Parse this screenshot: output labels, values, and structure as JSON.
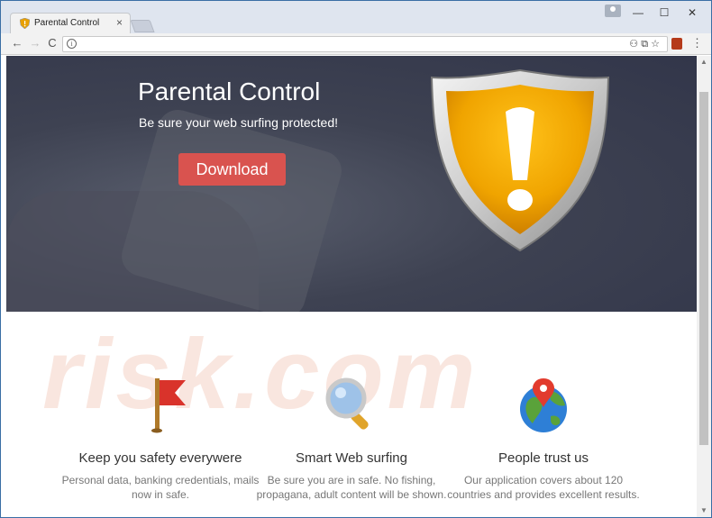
{
  "browser": {
    "tab_title": "Parental Control",
    "tab_close": "×",
    "controls": {
      "minimize": "—",
      "maximize": "☐",
      "close": "✕"
    },
    "nav": {
      "back": "←",
      "forward": "→",
      "reload": "C"
    },
    "omnibox_info": "i",
    "omnibox_icons": "⚇ ⧉ ☆",
    "menu": "⋮"
  },
  "hero": {
    "title": "Parental Control",
    "subtitle": "Be sure your web surfing protected!",
    "download_label": "Download"
  },
  "watermark": "risk.com",
  "features": [
    {
      "icon": "flag-icon",
      "title": "Keep you safety everywere",
      "desc": "Personal data, banking credentials, mails now in safe."
    },
    {
      "icon": "magnifier-icon",
      "title": "Smart Web surfing",
      "desc": "Be sure you are in safe. No fishing, propagana, adult content will be shown."
    },
    {
      "icon": "globe-pin-icon",
      "title": "People trust us",
      "desc": "Our application covers about 120 countries and provides excellent results."
    }
  ],
  "colors": {
    "download_button": "#d9534f",
    "shield_orange": "#f0a400",
    "window_border": "#3a6ea5"
  }
}
